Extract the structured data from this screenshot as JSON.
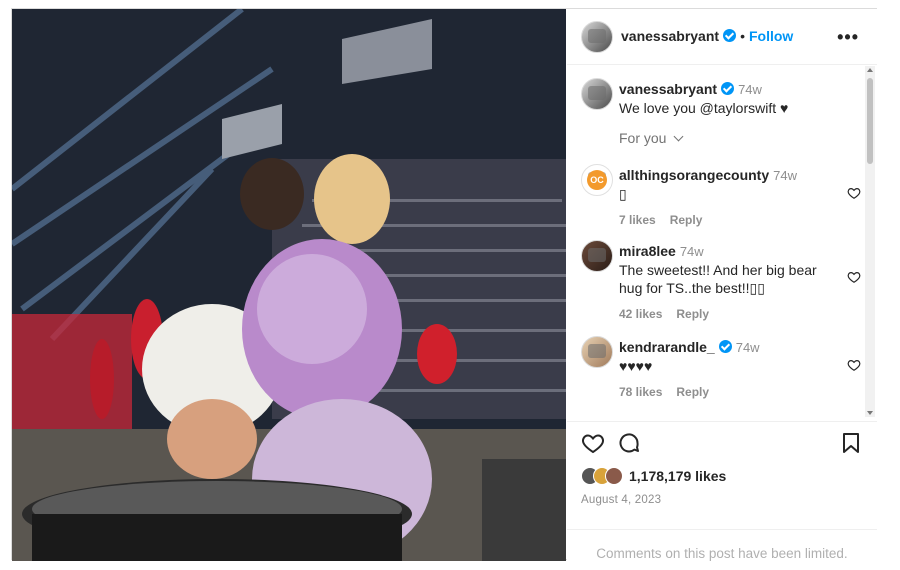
{
  "post": {
    "author": "vanessabryant",
    "follow_label": "Follow",
    "dot": "•",
    "more_label": "•••"
  },
  "caption": {
    "username": "vanessabryant",
    "time": "74w",
    "text": "We love you @taylorswift ♥"
  },
  "for_you_label": "For you",
  "comments": [
    {
      "username": "allthingsorangecounty",
      "time": "74w",
      "text": "▯",
      "likes": "7 likes",
      "reply": "Reply",
      "avatar_text": "OC",
      "verified": false
    },
    {
      "username": "mira8lee",
      "time": "74w",
      "text": "The sweetest!! And her big bear hug for TS..the best!!▯▯",
      "likes": "42 likes",
      "reply": "Reply",
      "verified": false
    },
    {
      "username": "kendrarandle_",
      "time": "74w",
      "text": "♥♥♥♥",
      "likes": "78 likes",
      "reply": "Reply",
      "verified": true
    }
  ],
  "likes_count": "1,178,179 likes",
  "date": "August 4, 2023",
  "limited_notice": "Comments on this post have been limited.",
  "colors": {
    "accent": "#0095f6",
    "text": "#262626",
    "muted": "#8e8e8e"
  },
  "icons": [
    "heart-icon",
    "comment-icon",
    "bookmark-icon",
    "more-icon",
    "verified-icon"
  ]
}
